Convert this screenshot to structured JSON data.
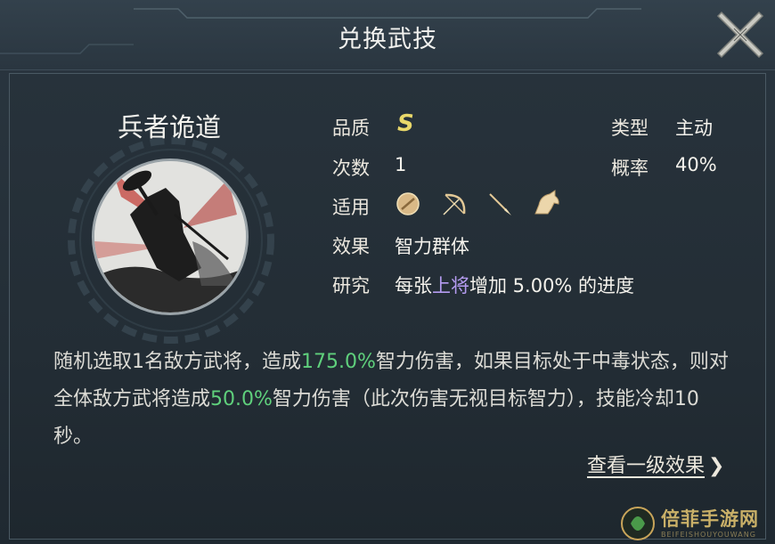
{
  "window": {
    "title": "兑换武技"
  },
  "skill": {
    "name": "兵者诡道"
  },
  "attributes": {
    "quality_label": "品质",
    "quality_value": "S",
    "count_label": "次数",
    "count_value": "1",
    "applies_label": "适用",
    "applies_icons": [
      "shield-icon",
      "bow-icon",
      "spear-icon",
      "horse-icon"
    ],
    "effect_label": "效果",
    "effect_value": "智力群体",
    "research_label": "研究",
    "research_prefix": "每张",
    "research_highlight": "上将",
    "research_suffix": "增加 5.00% 的进度",
    "type_label": "类型",
    "type_value": "主动",
    "rate_label": "概率",
    "rate_value": "40%"
  },
  "description": {
    "part1": "随机选取1名敌方武将，造成",
    "value1": "175.0%",
    "part2": "智力伤害，如果目标处于中毒状态，则对全体敌方武将造成",
    "value2": "50.0%",
    "part3": "智力伤害（此次伤害无视目标智力），技能冷却10秒。"
  },
  "links": {
    "view_level1": "查看一级效果"
  },
  "watermark": {
    "text": "倍菲手游网",
    "sub": "BEIFEISHOUYOUWANG"
  },
  "colors": {
    "grade": "#e9d86a",
    "highlight_purple": "#b49bf0",
    "highlight_green": "#5fd07c"
  }
}
